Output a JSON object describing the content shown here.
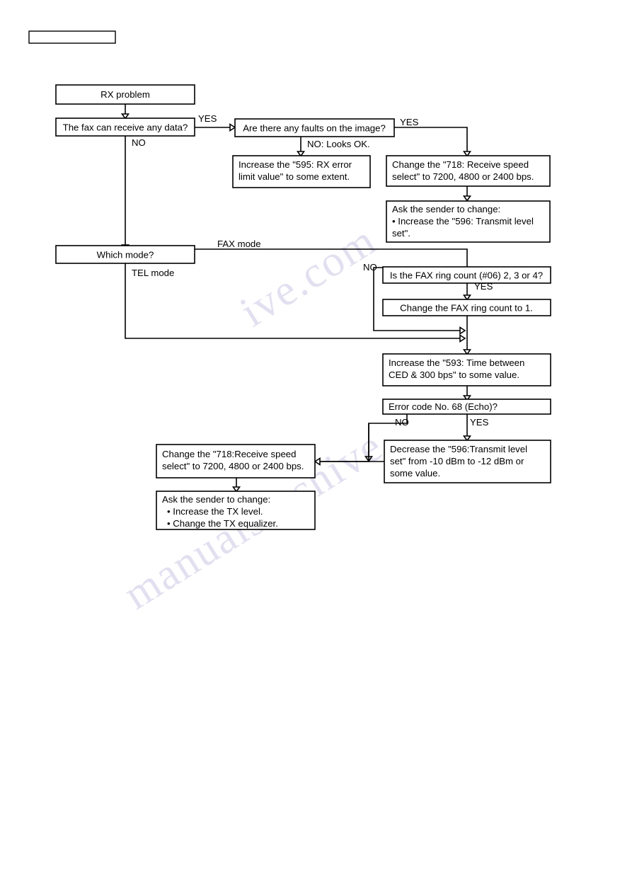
{
  "document": {
    "title": "RX problem troubleshooting flowchart",
    "header_box_label": "",
    "watermark_lines": [
      "ive.com",
      "manualsarchive"
    ]
  },
  "flowchart": {
    "type": "flowchart",
    "nodes": {
      "rx_problem": {
        "label": "RX problem"
      },
      "can_receive": {
        "label": "The fax can receive any data?"
      },
      "faults_on_image": {
        "label": "Are there any faults on the image?"
      },
      "increase_595": {
        "line1": "Increase the \"595: RX error",
        "line2": "limit value\" to some extent."
      },
      "change_718_top": {
        "line1": "Change the \"718: Receive speed",
        "line2": "select\" to 7200, 4800 or 2400 bps."
      },
      "ask_sender_596": {
        "line1": "Ask the sender to change:",
        "line2": "• Increase the \"596: Transmit level",
        "line3": "set\"."
      },
      "which_mode": {
        "label": "Which mode?"
      },
      "fax_ring_count": {
        "label": "Is the FAX ring count (#06) 2, 3 or 4?"
      },
      "change_ring_count": {
        "label": "Change the FAX ring count to 1."
      },
      "increase_593": {
        "line1": "Increase the \"593: Time between",
        "line2": "CED & 300 bps\" to some value."
      },
      "error_code_68": {
        "label": "Error code No. 68 (Echo)?"
      },
      "decrease_596": {
        "line1": "Decrease the \"596:Transmit level",
        "line2": "set\" from -10 dBm to -12 dBm or",
        "line3": "some value."
      },
      "change_718_bottom": {
        "line1": "Change the \"718:Receive speed",
        "line2": "select\" to 7200, 4800 or 2400 bps."
      },
      "ask_sender_tx": {
        "line1": "Ask the sender to change:",
        "line2": "• Increase the TX level.",
        "line3": "• Change the TX equalizer."
      }
    },
    "edge_labels": {
      "can_receive_yes": "YES",
      "can_receive_no": "NO",
      "faults_yes": "YES",
      "faults_no": "NO: Looks OK.",
      "mode_fax": "FAX mode",
      "mode_tel": "TEL mode",
      "ring_count_no": "NO",
      "ring_count_yes": "YES",
      "echo_no": "NO",
      "echo_yes": "YES"
    },
    "colors": {
      "line": "#000000",
      "box_fill": "#ffffff",
      "text": "#000000",
      "watermark": "#5a50a8"
    }
  }
}
